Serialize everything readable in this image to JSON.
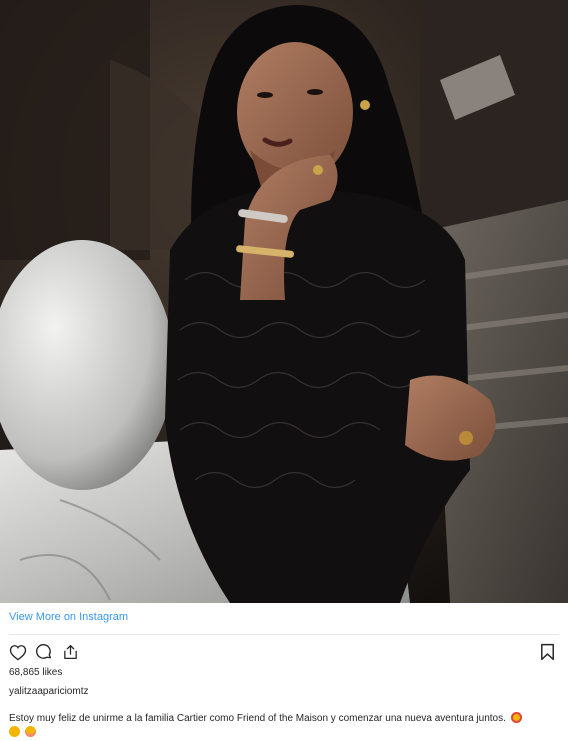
{
  "post": {
    "view_more_label": "View More on Instagram",
    "likes_text": "68,865 likes",
    "username": "yalitzaapariciomtz",
    "caption_text": "Estoy muy feliz de unirme a la familia Cartier como Friend of the Maison y comenzar una nueva aventura juntos.",
    "caption_emojis": [
      "heart-eyes-emoji",
      "star-struck-emoji",
      "blushing-emoji"
    ]
  },
  "icons": {
    "like": "heart-icon",
    "comment": "comment-icon",
    "share": "share-icon",
    "save": "bookmark-icon"
  },
  "colors": {
    "link": "#3897f0",
    "text": "#262626",
    "divider": "#e6e6e6",
    "emoji": "#f2b600"
  }
}
